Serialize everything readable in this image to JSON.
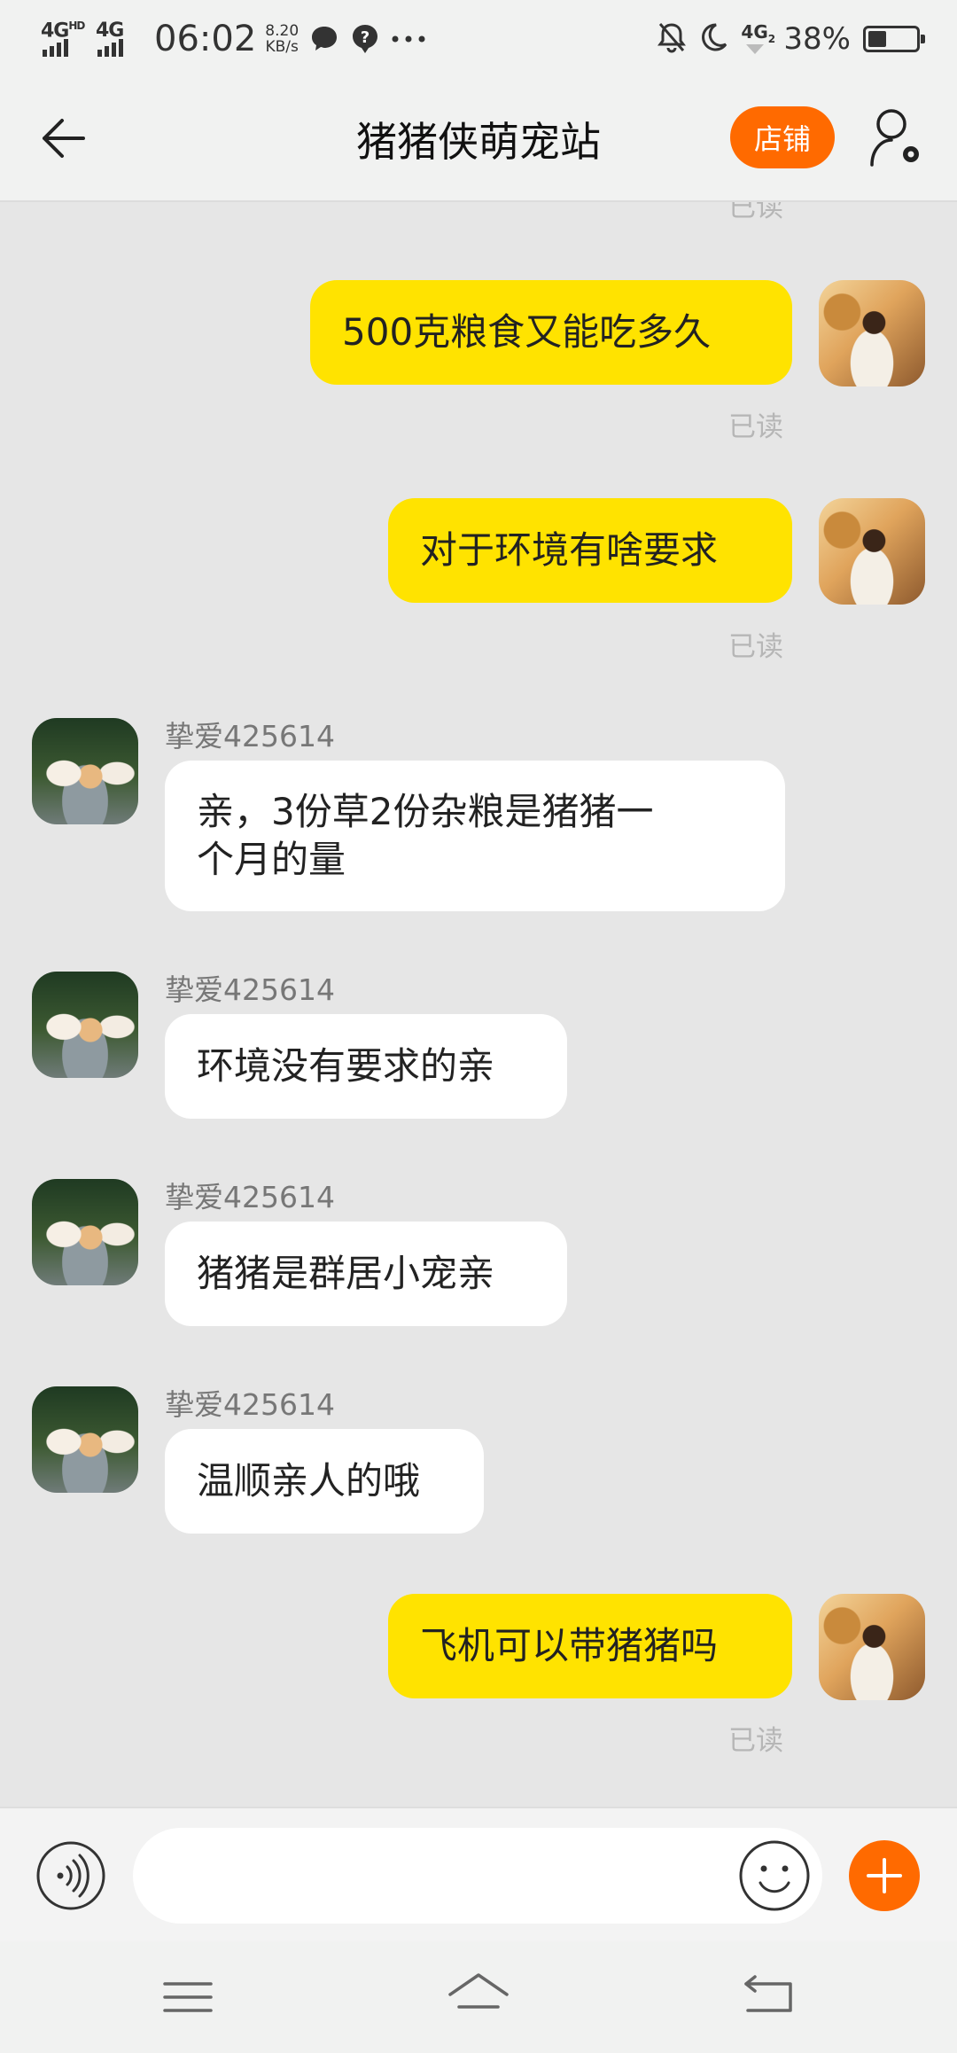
{
  "status_bar": {
    "net1": "4G",
    "net1_sup": "HD",
    "net2": "4G",
    "time": "06:02",
    "speed_value": "8.20",
    "speed_unit": "KB/s",
    "sim2_label": "4G",
    "sim2_sub": "2",
    "battery_percent": "38%",
    "battery_level": 0.38,
    "icons": [
      "chat-bubble-icon",
      "help-icon",
      "more-dots-icon",
      "bell-off-icon",
      "moon-icon",
      "battery-icon"
    ]
  },
  "header": {
    "title": "猪猪侠萌宠站",
    "shop_label": "店铺",
    "accent_color": "#ff6a00"
  },
  "chat": {
    "top_read_partial": "已读",
    "messages": [
      {
        "from": "me",
        "text": "500克粮食又能吃多久",
        "status": "已读"
      },
      {
        "from": "me",
        "text": "对于环境有啥要求",
        "status": "已读"
      },
      {
        "from": "other",
        "sender": "挚爱425614",
        "lines": [
          "亲，3份草2份杂粮是猪猪一",
          "个月的量"
        ]
      },
      {
        "from": "other",
        "sender": "挚爱425614",
        "text": "环境没有要求的亲"
      },
      {
        "from": "other",
        "sender": "挚爱425614",
        "text": "猪猪是群居小宠亲"
      },
      {
        "from": "other",
        "sender": "挚爱425614",
        "text": "温顺亲人的哦"
      },
      {
        "from": "me",
        "text": "飞机可以带猪猪吗",
        "status": "已读"
      }
    ],
    "me_bubble_color": "#ffe300",
    "other_bubble_color": "#ffffff"
  },
  "input": {
    "value": "",
    "placeholder": ""
  },
  "nav": {
    "icons": [
      "menu-icon",
      "home-icon",
      "back-icon"
    ]
  }
}
